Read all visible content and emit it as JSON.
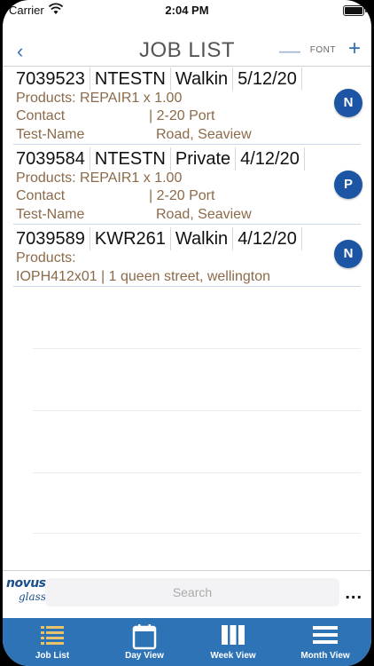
{
  "status_bar": {
    "carrier": "Carrier",
    "time": "2:04 PM"
  },
  "header": {
    "back_icon": "chevron-left-icon",
    "title": "JOB LIST",
    "font_label": "FONT",
    "minus_label": "—",
    "plus_label": "+"
  },
  "jobs": [
    {
      "job_no": "7039523",
      "code": "NTESTN",
      "type": "Walkin",
      "date": "5/12/20",
      "products": "Products: REPAIR1 x 1.00",
      "contact_label": "Contact",
      "address_1": "| 2-20 Port",
      "contact_name": "Test-Name",
      "address_2": "Road, Seaview",
      "badge": "N"
    },
    {
      "job_no": "7039584",
      "code": "NTESTN",
      "type": "Private",
      "date": "4/12/20",
      "products": "Products: REPAIR1 x 1.00",
      "contact_label": "Contact",
      "address_1": "| 2-20 Port",
      "contact_name": "Test-Name",
      "address_2": "Road, Seaview",
      "badge": "P"
    },
    {
      "job_no": "7039589",
      "code": "KWR261",
      "type": "Walkin",
      "date": "4/12/20",
      "products": "Products:",
      "detail": "IOPH412x01 | 1 queen street, wellington",
      "badge": "N"
    }
  ],
  "bottom": {
    "logo_line1": "novus",
    "logo_line2": "glass",
    "search_placeholder": "Search",
    "more_label": "..."
  },
  "tabs": [
    {
      "label": "Job List",
      "icon": "list-icon"
    },
    {
      "label": "Day View",
      "icon": "day-calendar-icon"
    },
    {
      "label": "Week View",
      "icon": "week-columns-icon"
    },
    {
      "label": "Month View",
      "icon": "month-rows-icon"
    }
  ],
  "colors": {
    "accent": "#2e73b6",
    "badge": "#1b55a3",
    "detail_text": "#8b6a4a",
    "active_tab_icon": "#e8c36a"
  }
}
